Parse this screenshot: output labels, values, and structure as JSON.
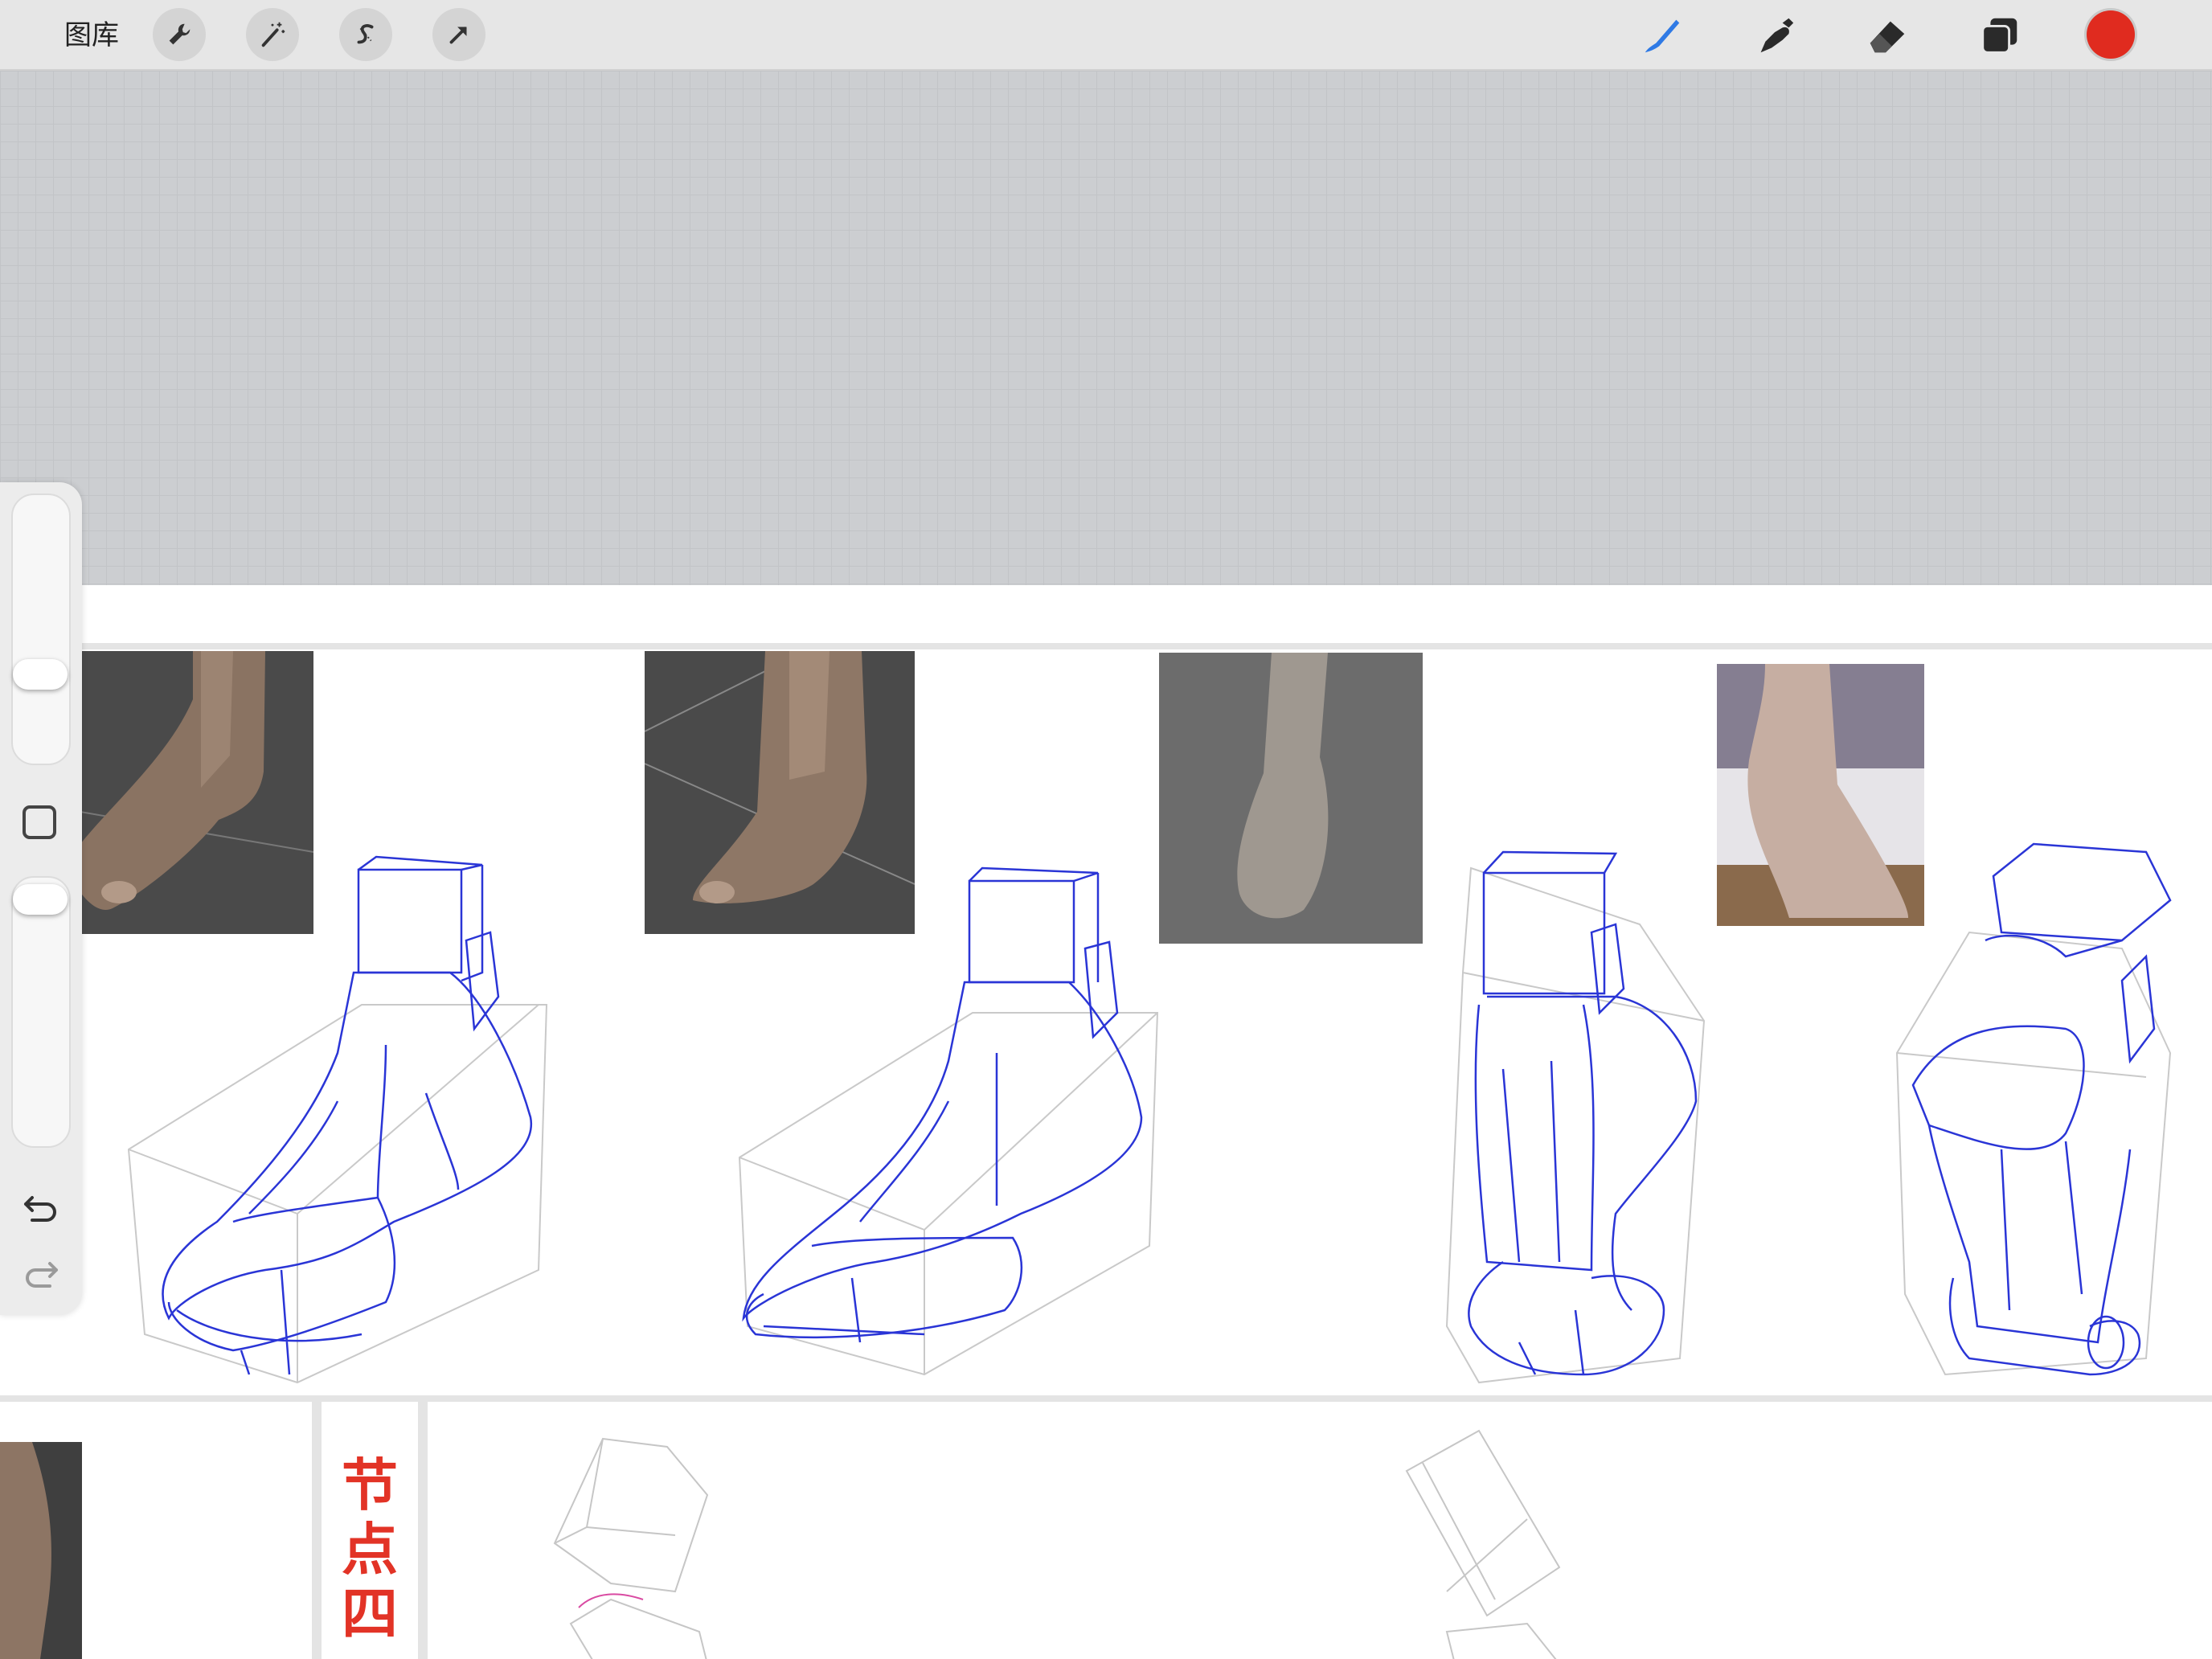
{
  "toolbar": {
    "gallery_label": "图库",
    "left_tools": [
      "wrench-icon",
      "magic-wand-icon",
      "selection-s-icon",
      "transform-arrow-icon"
    ],
    "right_tools": [
      "brush-icon",
      "smudge-icon",
      "eraser-icon",
      "layers-icon"
    ],
    "current_color": "#e02b1f",
    "active_tool": "brush"
  },
  "sidebar": {
    "brush_size_level": 0.53,
    "opacity_level": 0.0,
    "undo_icon": "undo-icon",
    "redo_icon": "redo-icon"
  },
  "canvas": {
    "node_label": "节点四",
    "label_color": "#e23326",
    "wireframe_color": "#2a35d6"
  }
}
